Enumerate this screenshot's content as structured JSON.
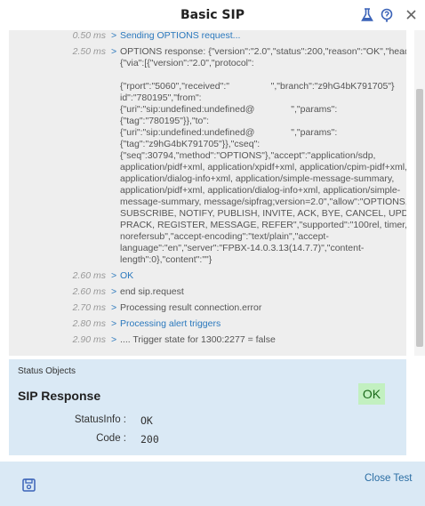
{
  "window": {
    "title": "Basic SIP",
    "icons": [
      "flask-icon",
      "help-icon",
      "close-icon"
    ]
  },
  "log": {
    "lines": [
      {
        "ts": "0.50 ms",
        "arrow": ">",
        "text": "Sending OPTIONS request...",
        "link": true
      },
      {
        "ts": "2.50 ms",
        "arrow": ">",
        "text": "OPTIONS response: {\"version\":\"2.0\",\"status\":200,\"reason\":\"OK\",\"head",
        "link": false
      },
      {
        "ts": "",
        "arrow": "",
        "text": "{\"via\":[{\"version\":\"2.0\",\"protocol\":",
        "link": false
      },
      {
        "ts": "",
        "arrow": "",
        "text": "",
        "link": false
      },
      {
        "ts": "",
        "arrow": "",
        "text": "{\"rport\":\"5060\",\"received\":\"                \",\"branch\":\"z9hG4bK791705\"}",
        "link": false
      },
      {
        "ts": "",
        "arrow": "",
        "text": "id\":\"780195\",\"from\":",
        "link": false
      },
      {
        "ts": "",
        "arrow": "",
        "text": "{\"uri\":\"sip:undefined:undefined@              \",\"params\":",
        "link": false
      },
      {
        "ts": "",
        "arrow": "",
        "text": "{\"tag\":\"780195\"}},\"to\":",
        "link": false
      },
      {
        "ts": "",
        "arrow": "",
        "text": "{\"uri\":\"sip:undefined:undefined@              \",\"params\":",
        "link": false
      },
      {
        "ts": "",
        "arrow": "",
        "text": "{\"tag\":\"z9hG4bK791705\"}},\"cseq\":",
        "link": false
      },
      {
        "ts": "",
        "arrow": "",
        "text": "{\"seq\":30794,\"method\":\"OPTIONS\"},\"accept\":\"application/sdp,",
        "link": false
      },
      {
        "ts": "",
        "arrow": "",
        "text": "application/pidf+xml, application/xpidf+xml, application/cpim-pidf+xml,",
        "link": false
      },
      {
        "ts": "",
        "arrow": "",
        "text": "application/dialog-info+xml, application/simple-message-summary,",
        "link": false
      },
      {
        "ts": "",
        "arrow": "",
        "text": "application/pidf+xml, application/dialog-info+xml, application/simple-",
        "link": false
      },
      {
        "ts": "",
        "arrow": "",
        "text": "message-summary, message/sipfrag;version=2.0\",\"allow\":\"OPTIONS,",
        "link": false
      },
      {
        "ts": "",
        "arrow": "",
        "text": "SUBSCRIBE, NOTIFY, PUBLISH, INVITE, ACK, BYE, CANCEL, UPDATE",
        "link": false
      },
      {
        "ts": "",
        "arrow": "",
        "text": "PRACK, REGISTER, MESSAGE, REFER\",\"supported\":\"100rel, timer, rep",
        "link": false
      },
      {
        "ts": "",
        "arrow": "",
        "text": "norefersub\",\"accept-encoding\":\"text/plain\",\"accept-",
        "link": false
      },
      {
        "ts": "",
        "arrow": "",
        "text": "language\":\"en\",\"server\":\"FPBX-14.0.3.13(14.7.7)\",\"content-",
        "link": false
      },
      {
        "ts": "",
        "arrow": "",
        "text": "length\":0},\"content\":\"\"}",
        "link": false
      },
      {
        "ts": "2.60 ms",
        "arrow": ">",
        "text": "OK",
        "link": true
      },
      {
        "ts": "2.60 ms",
        "arrow": ">",
        "text": "end sip.request",
        "link": false
      },
      {
        "ts": "2.70 ms",
        "arrow": ">",
        "text": "Processing result connection.error",
        "link": false
      },
      {
        "ts": "2.80 ms",
        "arrow": ">",
        "text": "Processing alert triggers",
        "link": true
      },
      {
        "ts": "2.90 ms",
        "arrow": ">",
        "text": ".... Trigger state for 1300:2277 = false",
        "link": false
      }
    ]
  },
  "status": {
    "section_label": "Status Objects",
    "title": "SIP Response",
    "badge": "OK",
    "badge_color": "#c2f0c0",
    "fields": [
      {
        "key": "StatusInfo",
        "value": "OK"
      },
      {
        "key": "Code",
        "value": "200"
      }
    ]
  },
  "footer": {
    "save_icon": "save-icon",
    "close_label": "Close Test"
  },
  "colors": {
    "link": "#2a78bd",
    "panel_bg": "#eeeeee",
    "status_bg": "#dae9f5"
  }
}
